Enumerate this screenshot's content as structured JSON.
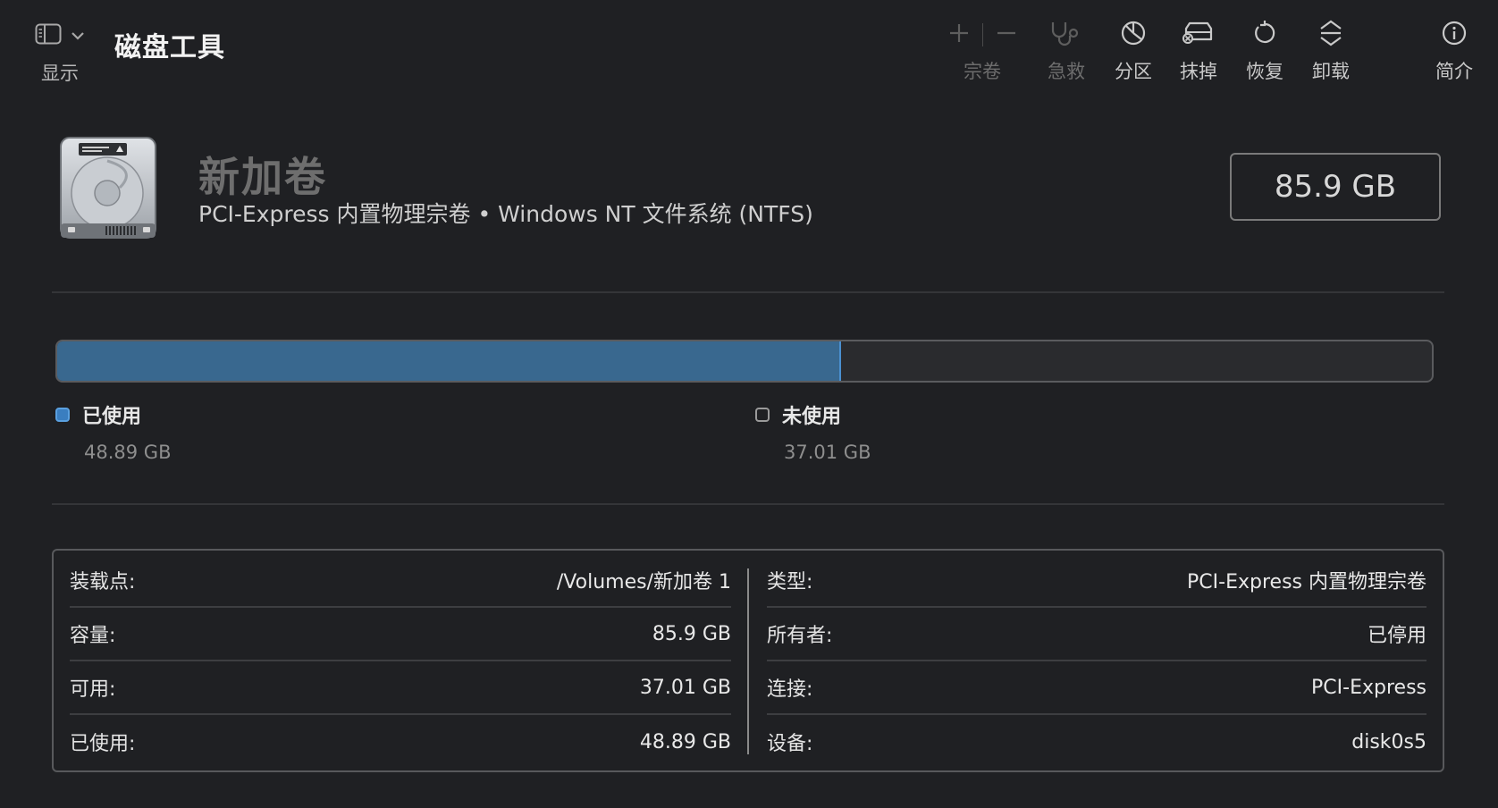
{
  "toolbar": {
    "view_label": "显示",
    "title": "磁盘工具",
    "volume_label": "宗卷",
    "first_aid_label": "急救",
    "partition_label": "分区",
    "erase_label": "抹掉",
    "restore_label": "恢复",
    "unmount_label": "卸载",
    "info_label": "简介",
    "icons": [
      "sidebar-icon",
      "chevron-down-icon",
      "plus-icon",
      "minus-icon",
      "stethoscope-icon",
      "pie-chart-icon",
      "erase-drive-icon",
      "restore-icon",
      "unmount-icon",
      "info-icon"
    ]
  },
  "volume": {
    "name": "新加卷",
    "description": "PCI-Express 内置物理宗卷 • Windows NT 文件系统 (NTFS)",
    "capacity": "85.9 GB"
  },
  "usage": {
    "used_fraction": 0.569,
    "used_label": "已使用",
    "used_value": "48.89 GB",
    "free_label": "未使用",
    "free_value": "37.01 GB",
    "used_color": "#39688f"
  },
  "info": {
    "left": [
      {
        "key": "装载点:",
        "value": "/Volumes/新加卷 1"
      },
      {
        "key": "容量:",
        "value": "85.9 GB"
      },
      {
        "key": "可用:",
        "value": "37.01 GB"
      },
      {
        "key": "已使用:",
        "value": "48.89 GB"
      }
    ],
    "right": [
      {
        "key": "类型:",
        "value": "PCI-Express 内置物理宗卷"
      },
      {
        "key": "所有者:",
        "value": "已停用"
      },
      {
        "key": "连接:",
        "value": "PCI-Express"
      },
      {
        "key": "设备:",
        "value": "disk0s5"
      }
    ]
  }
}
